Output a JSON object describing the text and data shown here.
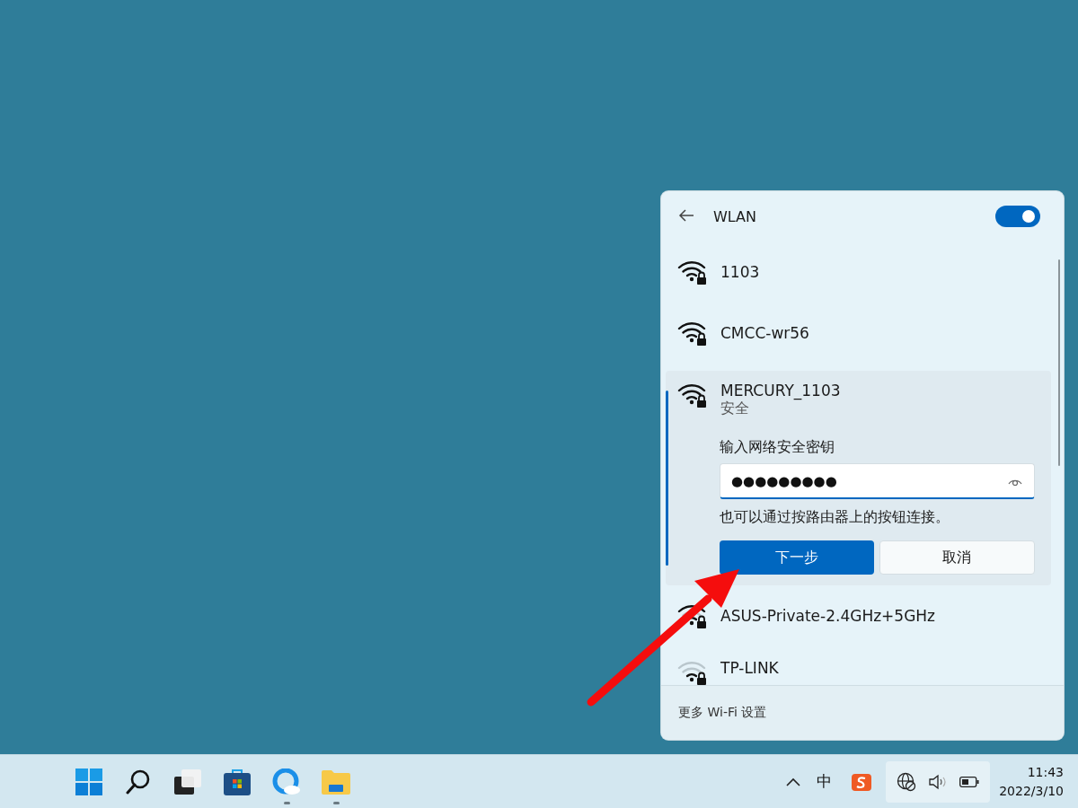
{
  "wlan_panel": {
    "title": "WLAN",
    "wifi_toggle": {
      "on": true
    },
    "networks": [
      {
        "name": "1103",
        "expanded": false
      },
      {
        "name": "CMCC-wr56",
        "expanded": false
      },
      {
        "name": "MERCURY_1103",
        "expanded": true,
        "status": "安全",
        "password_prompt": {
          "label": "输入网络安全密钥",
          "value": "●●●●●●●●●",
          "hint": "也可以通过按路由器上的按钮连接。",
          "buttons": [
            {
              "label": "下一步",
              "kind": "primary"
            },
            {
              "label": "取消",
              "kind": "secondary"
            }
          ]
        }
      },
      {
        "name": "ASUS-Private-2.4GHz+5GHz",
        "expanded": false
      },
      {
        "name": "TP-LINK",
        "expanded": false
      }
    ],
    "footer_link": "更多 Wi-Fi 设置"
  },
  "taskbar": {
    "apps": [
      {
        "kind": "start",
        "running": false
      },
      {
        "kind": "search",
        "running": false
      },
      {
        "kind": "taskview",
        "running": false
      },
      {
        "kind": "store",
        "running": false
      },
      {
        "kind": "browser",
        "running": true
      },
      {
        "kind": "explorer",
        "running": true
      }
    ],
    "tray": {
      "ime": "中",
      "time": "11:43",
      "date": "2022/3/10"
    }
  }
}
